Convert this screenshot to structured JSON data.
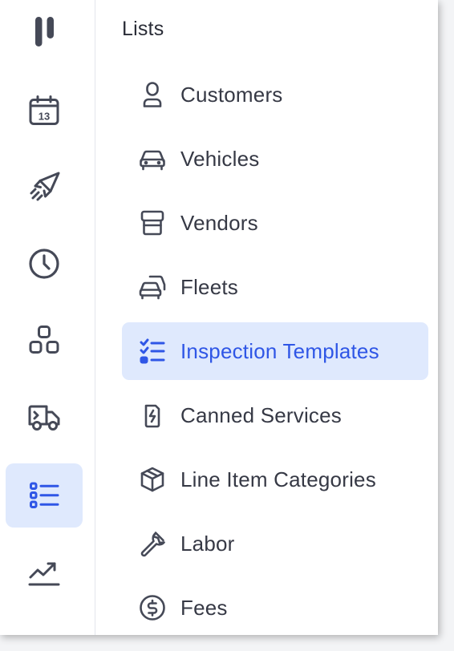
{
  "colors": {
    "accent": "#2f56e6",
    "active_bg": "#dfe9fd",
    "icon": "#454957",
    "text": "#363945"
  },
  "rail": {
    "items": [
      {
        "icon": "pause-icon",
        "active": false
      },
      {
        "icon": "calendar-icon",
        "badge": "13",
        "active": false
      },
      {
        "icon": "rocket-icon",
        "active": false
      },
      {
        "icon": "clock-icon",
        "active": false
      },
      {
        "icon": "apps-icon",
        "active": false
      },
      {
        "icon": "delivery-truck-icon",
        "active": false
      },
      {
        "icon": "list-icon",
        "active": true
      },
      {
        "icon": "trending-up-icon",
        "active": false
      }
    ]
  },
  "panel": {
    "title": "Lists",
    "items": [
      {
        "label": "Customers",
        "icon": "user-icon",
        "active": false
      },
      {
        "label": "Vehicles",
        "icon": "car-icon",
        "active": false
      },
      {
        "label": "Vendors",
        "icon": "storefront-icon",
        "active": false
      },
      {
        "label": "Fleets",
        "icon": "fleet-icon",
        "active": false
      },
      {
        "label": "Inspection Templates",
        "icon": "checklist-icon",
        "active": true
      },
      {
        "label": "Canned Services",
        "icon": "battery-charge-icon",
        "active": false
      },
      {
        "label": "Line Item Categories",
        "icon": "package-icon",
        "active": false
      },
      {
        "label": "Labor",
        "icon": "wrench-icon",
        "active": false
      },
      {
        "label": "Fees",
        "icon": "dollar-circle-icon",
        "active": false
      }
    ]
  }
}
